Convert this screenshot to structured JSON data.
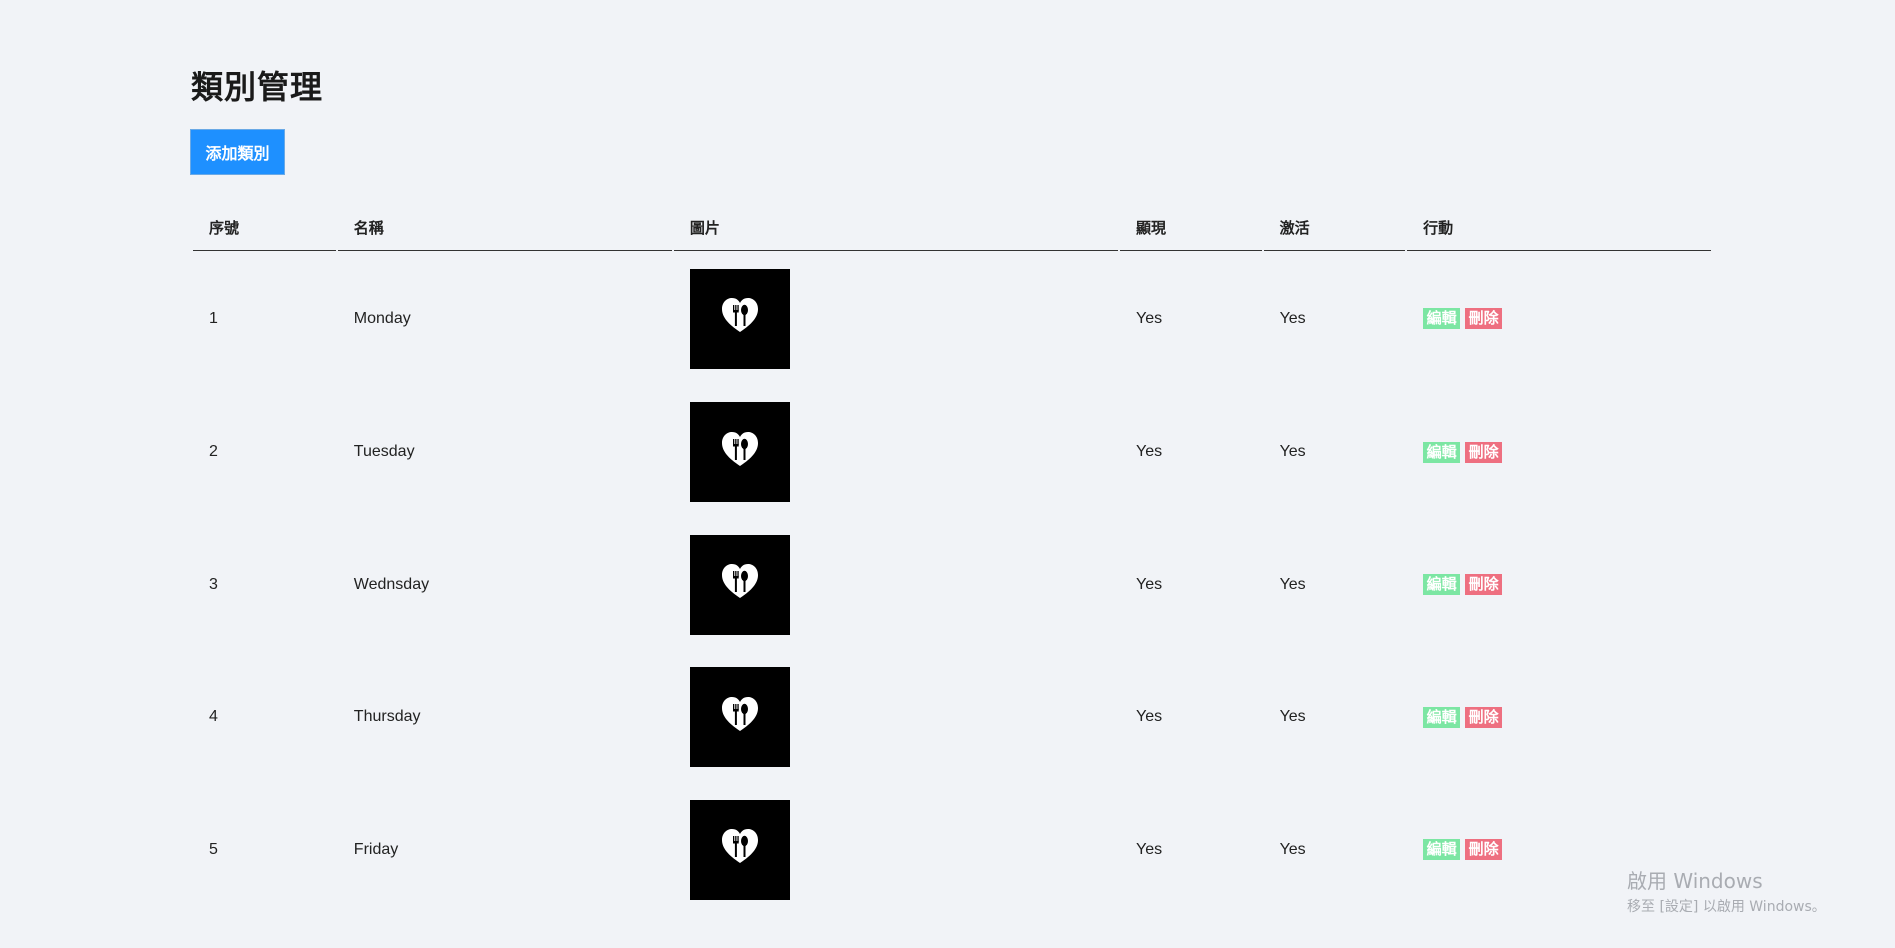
{
  "page": {
    "title": "類別管理",
    "add_button_label": "添加類別"
  },
  "table": {
    "headers": [
      "序號",
      "名稱",
      "圖片",
      "顯現",
      "激活",
      "行動"
    ],
    "rows": [
      {
        "index": "1",
        "name": "Monday",
        "image": "heart-fork-spoon-icon",
        "visible": "Yes",
        "active": "Yes",
        "edit_label": "編輯",
        "delete_label": "刪除"
      },
      {
        "index": "2",
        "name": "Tuesday",
        "image": "heart-fork-spoon-icon",
        "visible": "Yes",
        "active": "Yes",
        "edit_label": "編輯",
        "delete_label": "刪除"
      },
      {
        "index": "3",
        "name": "Wednsday",
        "image": "heart-fork-spoon-icon",
        "visible": "Yes",
        "active": "Yes",
        "edit_label": "編輯",
        "delete_label": "刪除"
      },
      {
        "index": "4",
        "name": "Thursday",
        "image": "heart-fork-spoon-icon",
        "visible": "Yes",
        "active": "Yes",
        "edit_label": "編輯",
        "delete_label": "刪除"
      },
      {
        "index": "5",
        "name": "Friday",
        "image": "heart-fork-spoon-icon",
        "visible": "Yes",
        "active": "Yes",
        "edit_label": "編輯",
        "delete_label": "刪除"
      }
    ]
  },
  "watermark": {
    "line1": "啟用 Windows",
    "line2": "移至 [設定] 以啟用 Windows。"
  },
  "colors": {
    "background": "#f1f3f7",
    "primary": "#1e90ff",
    "edit": "#7ce6a3",
    "delete": "#ee6f80"
  }
}
